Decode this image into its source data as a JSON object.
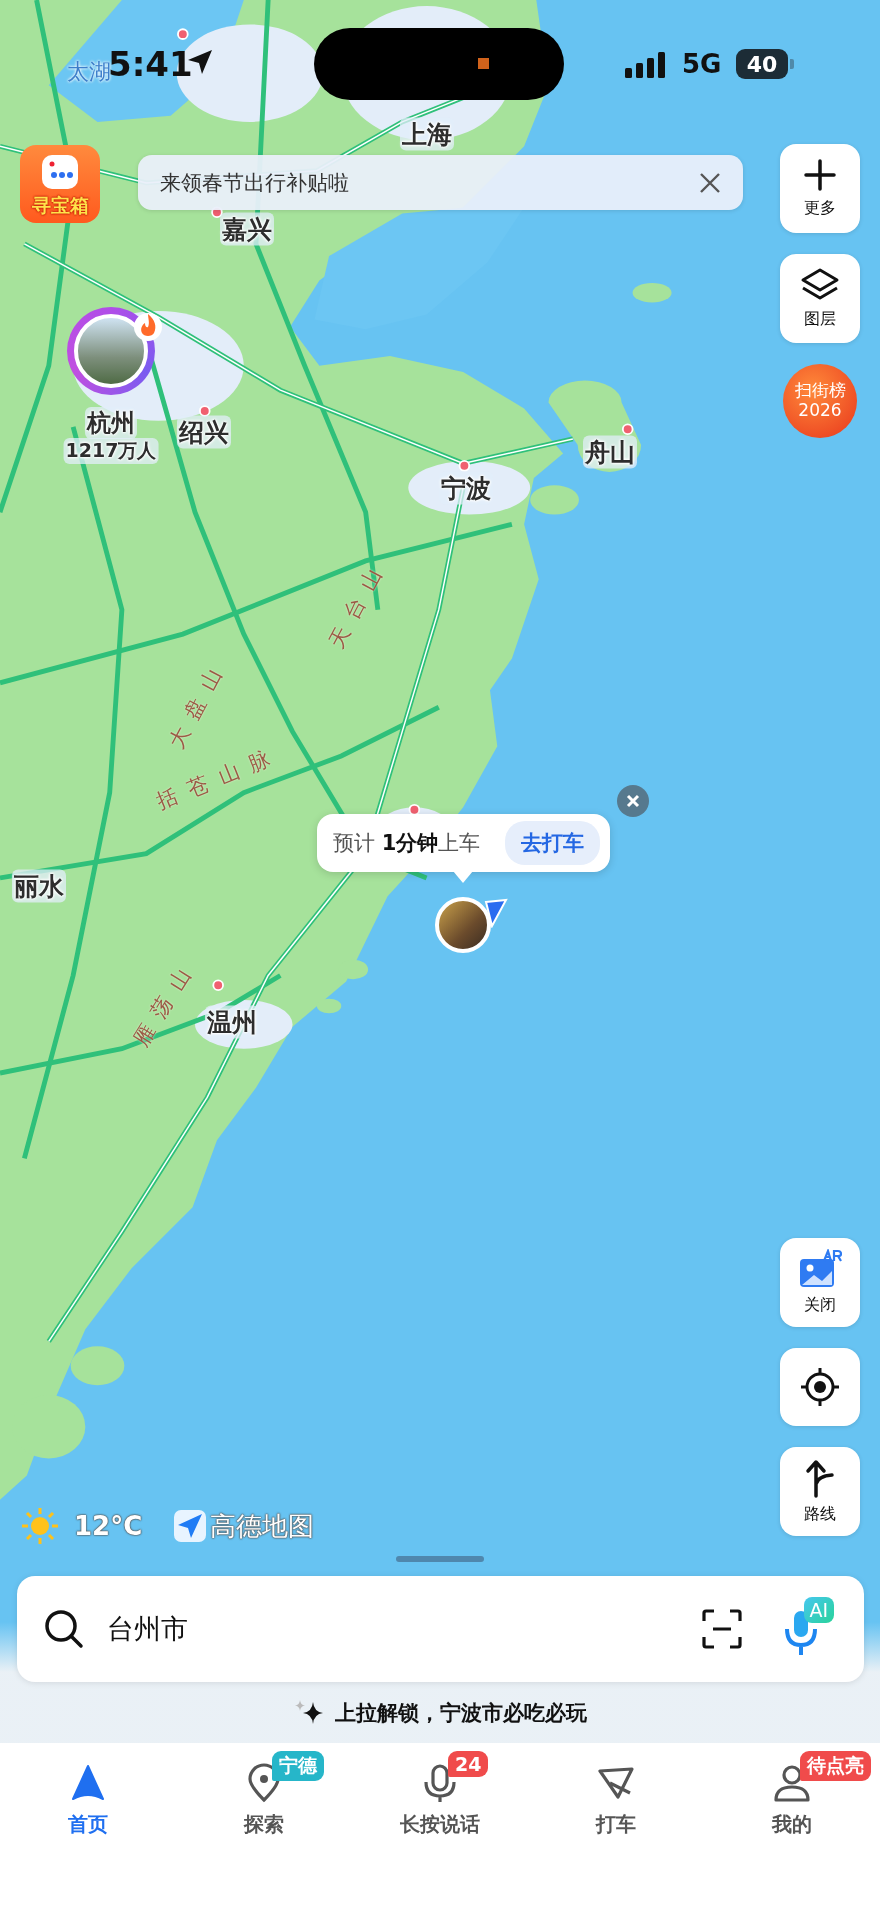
{
  "status_bar": {
    "time": "5:41",
    "network": "5G",
    "battery": "40"
  },
  "treasure_button": {
    "label": "寻宝箱"
  },
  "banner": {
    "text": "来领春节出行补贴啦"
  },
  "map_labels": [
    {
      "text": "太湖",
      "kind": "water"
    },
    {
      "text": "上海",
      "kind": "city"
    },
    {
      "text": "嘉兴",
      "kind": "city"
    },
    {
      "text": "绍兴",
      "kind": "city"
    },
    {
      "text": "舟山",
      "kind": "city"
    },
    {
      "text": "宁波",
      "kind": "city"
    },
    {
      "text": "天台山",
      "kind": "mountain"
    },
    {
      "text": "大盘山",
      "kind": "mountain"
    },
    {
      "text": "括苍山脉",
      "kind": "mountain"
    },
    {
      "text": "丽水",
      "kind": "city"
    },
    {
      "text": "雁荡山",
      "kind": "mountain"
    },
    {
      "text": "温州",
      "kind": "city"
    }
  ],
  "city_marker": {
    "name": "杭州",
    "population": "1217万人"
  },
  "ride_popup": {
    "text": "预计 **1分钟**上车",
    "button": "去打车"
  },
  "side_buttons_top": [
    {
      "kind": "plus",
      "label": "更多"
    },
    {
      "kind": "layers",
      "label": "图层"
    }
  ],
  "ranking_badge": {
    "line1": "扫街榜",
    "line2": "2026"
  },
  "side_buttons_bottom": [
    {
      "kind": "ar",
      "label": "关闭"
    },
    {
      "kind": "locate"
    },
    {
      "kind": "route",
      "label": "路线"
    }
  ],
  "weather": {
    "temperature": "12°C"
  },
  "map_logo": {
    "text": "高德地图"
  },
  "search": {
    "value": "台州市",
    "ai_badge": "AI"
  },
  "hint": "上拉解锁，宁波市必吃必玩",
  "tabs": [
    {
      "kind": "home",
      "label": "首页",
      "selected": true
    },
    {
      "kind": "explore",
      "label": "探索",
      "selected": false,
      "badge": "宁德",
      "color": "#26b6c9"
    },
    {
      "kind": "voice",
      "label": "长按说话",
      "selected": false,
      "badge": "24",
      "color": "#f04b4b"
    },
    {
      "kind": "taxi",
      "label": "打车",
      "selected": false
    },
    {
      "kind": "profile",
      "label": "我的",
      "selected": false,
      "badge": "待点亮",
      "color": "#f04b4b"
    }
  ]
}
